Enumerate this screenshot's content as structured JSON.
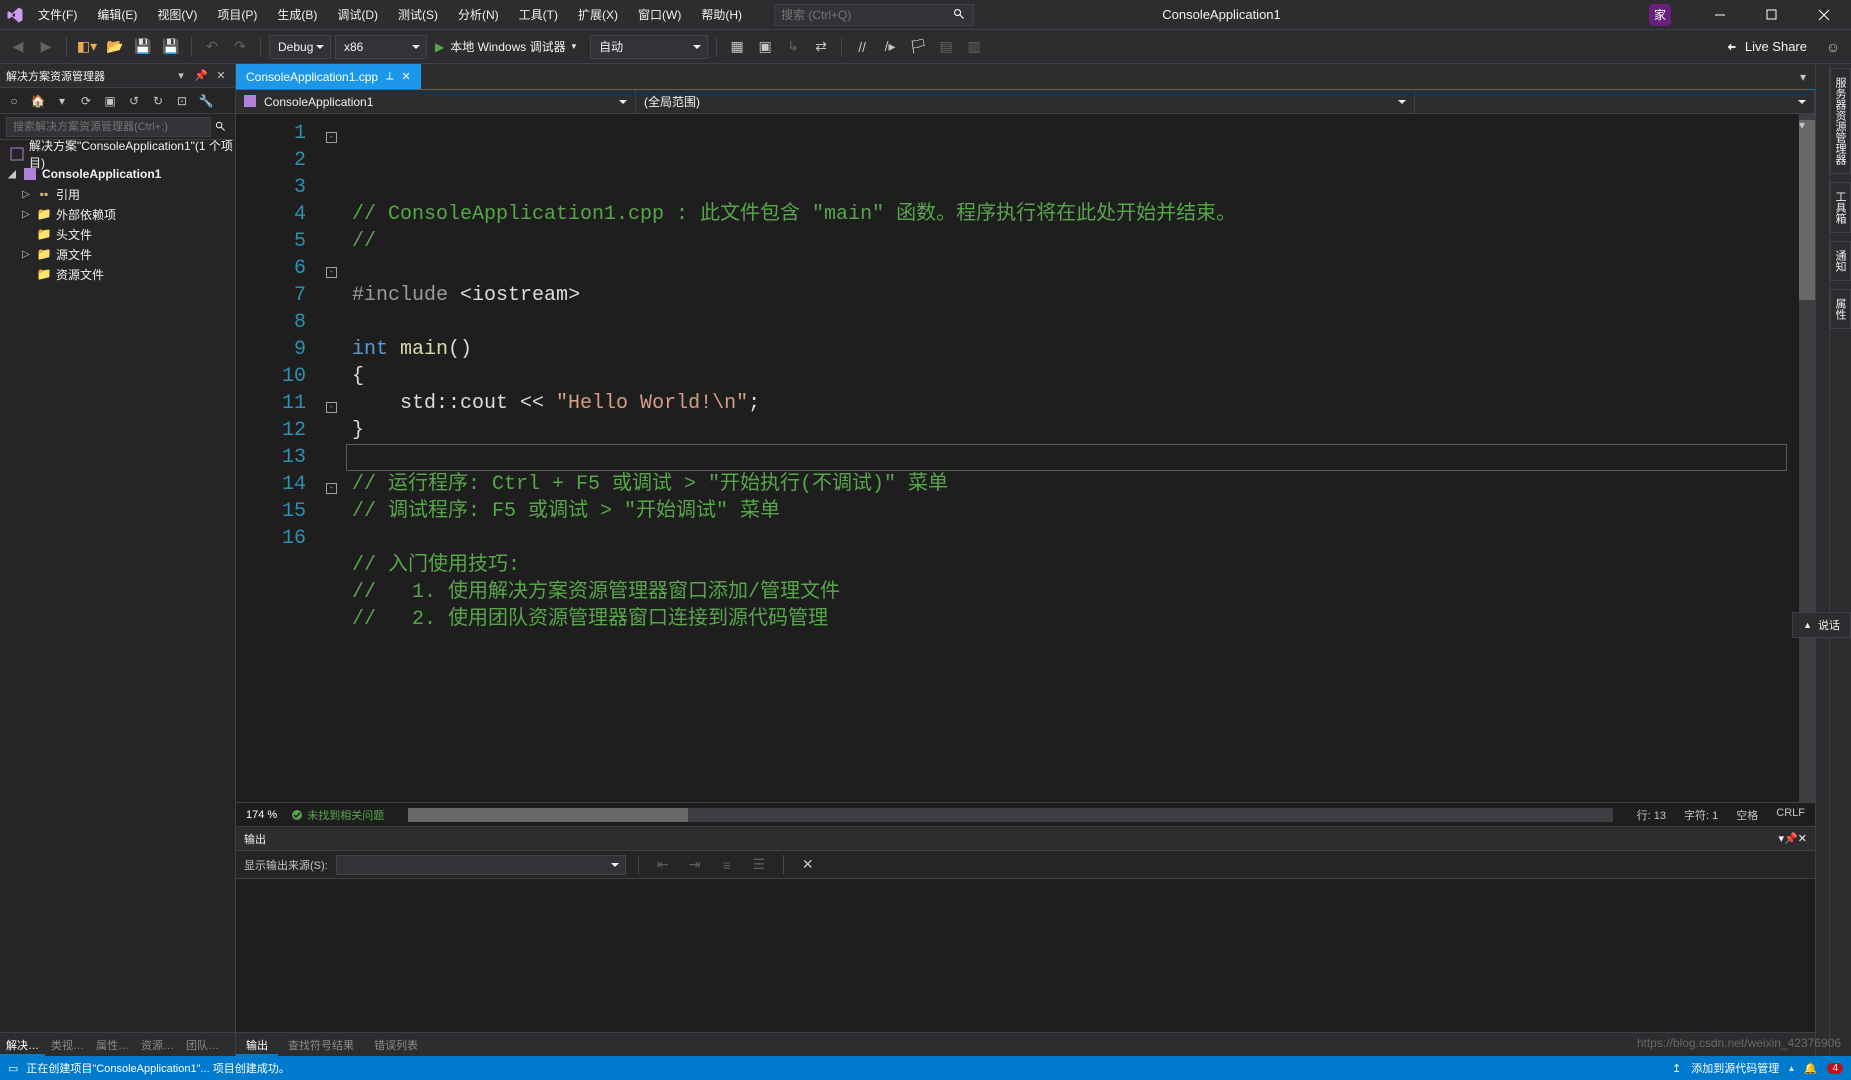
{
  "title_project": "ConsoleApplication1",
  "user_badge": "家",
  "menu": {
    "file": "文件(F)",
    "edit": "编辑(E)",
    "view": "视图(V)",
    "project": "项目(P)",
    "build": "生成(B)",
    "debug": "调试(D)",
    "test": "测试(S)",
    "analyze": "分析(N)",
    "tools": "工具(T)",
    "extensions": "扩展(X)",
    "window": "窗口(W)",
    "help": "帮助(H)"
  },
  "search_placeholder": "搜索 (Ctrl+Q)",
  "toolbar": {
    "config": "Debug",
    "platform": "x86",
    "run_label": "本地 Windows 调试器",
    "auto": "自动",
    "live_share": "Live Share"
  },
  "solution_explorer": {
    "title": "解决方案资源管理器",
    "search_placeholder": "搜索解决方案资源管理器(Ctrl+;)",
    "root": "解决方案\"ConsoleApplication1\"(1 个项目)",
    "project": "ConsoleApplication1",
    "nodes": {
      "refs": "引用",
      "externals": "外部依赖项",
      "headers": "头文件",
      "sources": "源文件",
      "resources": "资源文件"
    },
    "tabs": {
      "solution": "解决…",
      "class": "类视…",
      "property": "属性…",
      "resource": "资源…",
      "team": "团队…"
    }
  },
  "doc_tab": "ConsoleApplication1.cpp",
  "nav": {
    "scope1": "ConsoleApplication1",
    "scope2": "(全局范围)"
  },
  "code_lines": [
    {
      "n": 1,
      "html": "<span class='c-comment'>// ConsoleApplication1.cpp : 此文件包含 \"main\" 函数。程序执行将在此处开始并结束。</span>"
    },
    {
      "n": 2,
      "html": "<span class='c-comment'>//</span>"
    },
    {
      "n": 3,
      "html": ""
    },
    {
      "n": 4,
      "html": "<span class='c-include'>#include</span> <span class='c-angle'>&lt;</span><span>iostream</span><span class='c-angle'>&gt;</span>"
    },
    {
      "n": 5,
      "html": ""
    },
    {
      "n": 6,
      "html": "<span class='c-keyword'>int</span> <span class='c-func'>main</span>()"
    },
    {
      "n": 7,
      "html": "{"
    },
    {
      "n": 8,
      "html": "    std::cout &lt;&lt; <span class='c-string'>\"Hello World!\\n\"</span>;"
    },
    {
      "n": 9,
      "html": "}"
    },
    {
      "n": 10,
      "html": ""
    },
    {
      "n": 11,
      "html": "<span class='c-comment'>// 运行程序: Ctrl + F5 或调试 &gt; \"开始执行(不调试)\" 菜单</span>"
    },
    {
      "n": 12,
      "html": "<span class='c-comment'>// 调试程序: F5 或调试 &gt; \"开始调试\" 菜单</span>"
    },
    {
      "n": 13,
      "html": ""
    },
    {
      "n": 14,
      "html": "<span class='c-comment'>// 入门使用技巧: </span>"
    },
    {
      "n": 15,
      "html": "<span class='c-comment'>//   1. 使用解决方案资源管理器窗口添加/管理文件</span>"
    },
    {
      "n": 16,
      "html": "<span class='c-comment'>//   2. 使用团队资源管理器窗口连接到源代码管理</span>"
    }
  ],
  "fold": {
    "1": "-",
    "6": "-",
    "11": "-",
    "14": "-"
  },
  "editor_status": {
    "zoom": "174 %",
    "issues": "未找到相关问题",
    "line": "行: 13",
    "char": "字符: 1",
    "spaces": "空格",
    "eol": "CRLF"
  },
  "right_tabs": {
    "server": "服务器资源管理器",
    "toolbox": "工具箱",
    "notify": "通知",
    "props": "属性"
  },
  "output": {
    "title": "输出",
    "show_source": "显示输出来源(S):",
    "tabs": {
      "output": "输出",
      "findsym": "查找符号结果",
      "errorlist": "错误列表"
    }
  },
  "statusbar": {
    "building": "正在创建项目\"ConsoleApplication1\"... 项目创建成功。",
    "add_to_scm": "添加到源代码管理",
    "notif_count": "4"
  },
  "float_tag": "说话",
  "watermark": "https://blog.csdn.net/weixin_42376906"
}
